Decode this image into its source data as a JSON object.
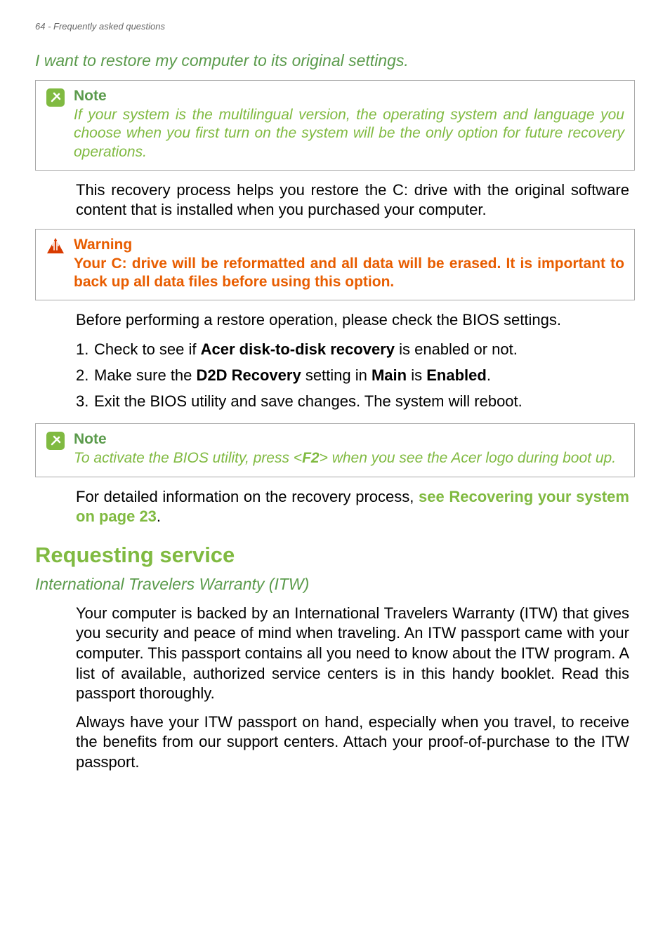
{
  "header": "64 - Frequently asked questions",
  "sub1": "I want to restore my computer to its original settings.",
  "note1": {
    "title": "Note",
    "body": "If your system is the multilingual version, the operating system and language you choose when you first turn on the system will be the only option for future recovery operations."
  },
  "p1": "This recovery process helps you restore the C: drive with the original software content that is installed when you purchased your computer.",
  "warn": {
    "title": "Warning",
    "body": "Your C: drive will be reformatted and all data will be erased. It is important to back up all data files before using this option."
  },
  "p2": "Before performing a restore operation, please check the BIOS settings.",
  "list": {
    "it1_a": "Check to see if ",
    "it1_b": "Acer disk-to-disk recovery",
    "it1_c": " is enabled or not.",
    "it2_a": "Make sure the ",
    "it2_b": "D2D Recovery",
    "it2_c": " setting in ",
    "it2_d": "Main",
    "it2_e": " is ",
    "it2_f": "Enabled",
    "it2_g": ".",
    "it3": "Exit the BIOS utility and save changes. The system will reboot."
  },
  "note2": {
    "title": "Note",
    "body_a": "To activate the BIOS utility, press <",
    "body_b": "F2",
    "body_c": "> when you see the Acer logo during boot up."
  },
  "p3_a": "For detailed information on the recovery process, ",
  "p3_link": "see Recovering your system on page 23",
  "p3_c": ".",
  "h2": "Requesting service",
  "sub2": "International Travelers Warranty (ITW)",
  "p4": "Your computer is backed by an International Travelers Warranty (ITW) that gives you security and peace of mind when traveling. An ITW passport came with your computer. This passport contains all you need to know about the ITW program. A list of available, authorized service centers is in this handy booklet. Read this passport thoroughly.",
  "p5": "Always have your ITW passport on hand, especially when you travel, to receive the benefits from our support centers. Attach your proof-of-purchase to the ITW passport."
}
